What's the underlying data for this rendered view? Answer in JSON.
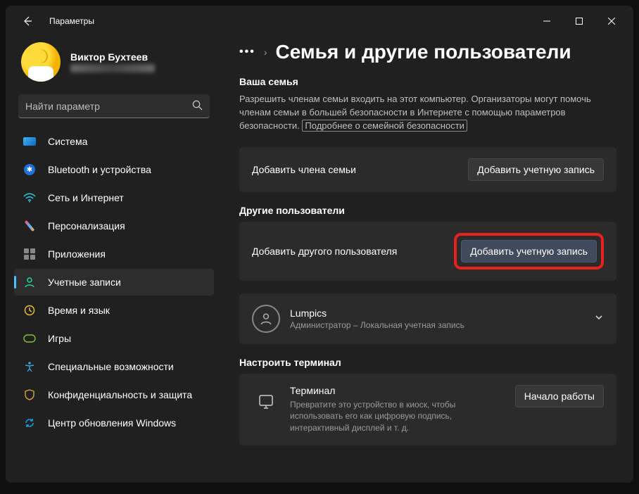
{
  "titlebar": {
    "title": "Параметры"
  },
  "profile": {
    "name": "Виктор Бухтеев"
  },
  "search": {
    "placeholder": "Найти параметр"
  },
  "nav": [
    {
      "label": "Система",
      "id": "system"
    },
    {
      "label": "Bluetooth и устройства",
      "id": "bluetooth"
    },
    {
      "label": "Сеть и Интернет",
      "id": "network"
    },
    {
      "label": "Персонализация",
      "id": "personalization"
    },
    {
      "label": "Приложения",
      "id": "apps"
    },
    {
      "label": "Учетные записи",
      "id": "accounts"
    },
    {
      "label": "Время и язык",
      "id": "time"
    },
    {
      "label": "Игры",
      "id": "gaming"
    },
    {
      "label": "Специальные возможности",
      "id": "accessibility"
    },
    {
      "label": "Конфиденциальность и защита",
      "id": "privacy"
    },
    {
      "label": "Центр обновления Windows",
      "id": "update"
    }
  ],
  "page": {
    "title": "Семья и другие пользователи",
    "family": {
      "header": "Ваша семья",
      "desc_pre": "Разрешить членам семьи входить на этот компьютер. Организаторы могут помочь членам семьи в большей безопасности в Интернете с помощью параметров безопасности.",
      "link": "Подробнее о семейной безопасности",
      "add_label": "Добавить члена семьи",
      "add_button": "Добавить учетную запись"
    },
    "others": {
      "header": "Другие пользователи",
      "add_label": "Добавить другого пользователя",
      "add_button": "Добавить учетную запись",
      "user": {
        "name": "Lumpics",
        "role": "Администратор – Локальная учетная запись"
      }
    },
    "terminal": {
      "header": "Настроить терминал",
      "name": "Терминал",
      "desc": "Превратите это устройство в киоск, чтобы использовать его как цифровую подпись, интерактивный дисплей и т. д.",
      "button": "Начало работы"
    }
  }
}
